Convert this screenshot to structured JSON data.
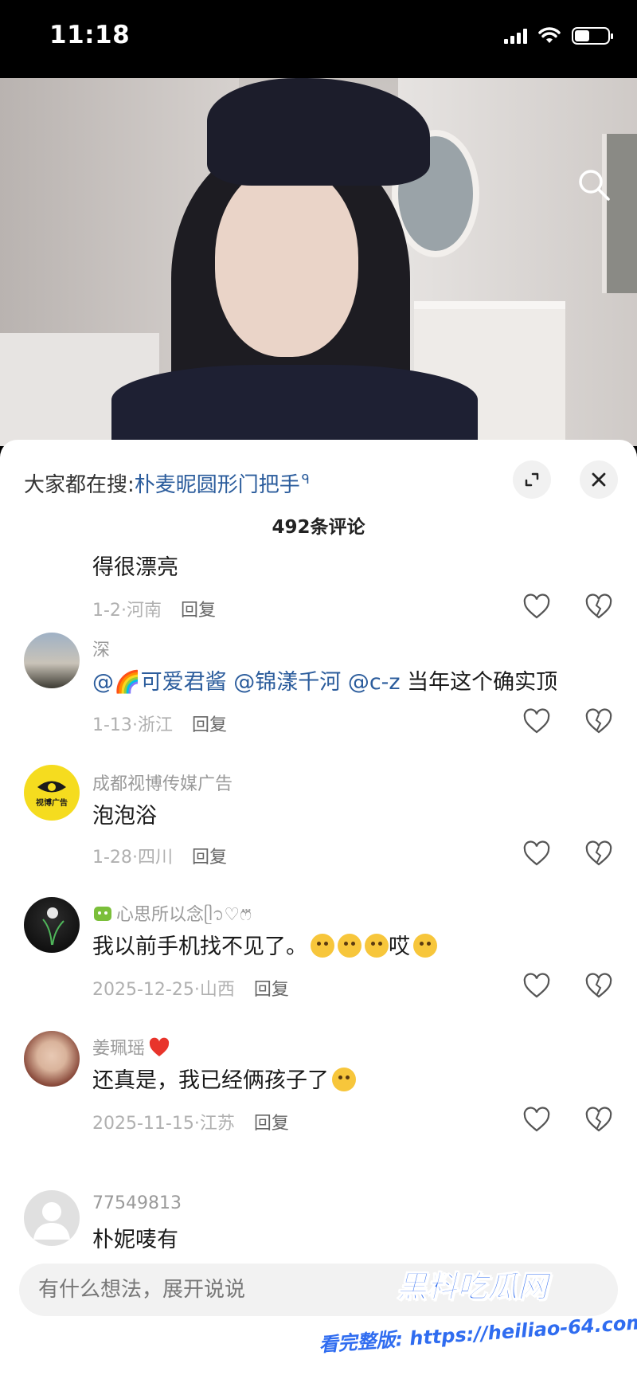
{
  "status_bar": {
    "time": "11:18",
    "battery_level": 0.45
  },
  "search_bar": {
    "prefix": "大家都在搜:",
    "query": "朴麦昵圆形门把手",
    "query_icon": "ᑫ"
  },
  "comment_count": "492条评论",
  "comments": [
    {
      "username": "",
      "text": "得很漂亮",
      "date": "1-2",
      "location": "河南",
      "reply": "回复"
    },
    {
      "username": "深",
      "mention1": "@🌈可爱君酱",
      "mention2": "@锦漾千河",
      "mention3": "@c-z",
      "text": "当年这个确实顶",
      "date": "1-13",
      "location": "浙江",
      "reply": "回复"
    },
    {
      "username": "成都视博传媒广告",
      "avatar_label": "视博广告",
      "text": "泡泡浴",
      "date": "1-28",
      "location": "四川",
      "reply": "回复"
    },
    {
      "username": "心思所以念ᥫ᭡♡ෆ⃛",
      "text": "我以前手机找不见了。",
      "tail": "哎",
      "date": "2025-12-25",
      "location": "山西",
      "reply": "回复"
    },
    {
      "username": "姜珮瑶",
      "text": "还真是，我已经俩孩子了",
      "date": "2025-11-15",
      "location": "江苏",
      "reply": "回复"
    },
    {
      "username": "77549813",
      "text": "朴妮唛有"
    }
  ],
  "input": {
    "placeholder": "有什么想法，展开说说"
  },
  "watermark": {
    "title": "黑料吃瓜网",
    "url": "看完整版: https://heiliao-64.com"
  },
  "separator": "·",
  "colors": {
    "link": "#2b5c9c",
    "watermark": "#2f6cf0"
  }
}
